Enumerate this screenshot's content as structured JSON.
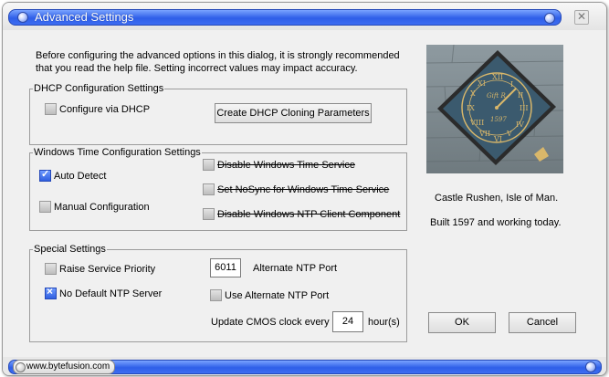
{
  "window": {
    "title": "Advanced Settings",
    "close_glyph": "✕"
  },
  "intro": {
    "line1": "Before configuring the advanced options in this dialog, it is strongly recommended",
    "line2": "that you read the help file. Setting incorrect values may impact accuracy."
  },
  "dhcp": {
    "legend": "DHCP Configuration Settings",
    "configure_label": "Configure via DHCP",
    "configure_checked": false,
    "create_button": "Create DHCP Cloning Parameters"
  },
  "windows_time": {
    "legend": "Windows Time  Configuration Settings",
    "auto_detect_label": "Auto Detect",
    "auto_detect_checked": true,
    "manual_label": "Manual Configuration",
    "manual_checked": false,
    "disable_service_label": "Disable Windows Time Service",
    "nosync_label": "Set NoSync for Windows Time Service",
    "disable_ntp_client_label": "Disable Windows NTP Client Component"
  },
  "special": {
    "legend": "Special Settings",
    "raise_priority_label": "Raise Service Priority",
    "no_default_ntp_label": "No Default NTP Server",
    "port_value": "6011",
    "alt_port_label": "Alternate NTP Port",
    "use_alt_port_label": "Use Alternate NTP Port",
    "cmos_label": "Update CMOS clock every",
    "cmos_value": "24",
    "cmos_unit": "hour(s)"
  },
  "photo": {
    "caption1": "Castle Rushen, Isle of Man.",
    "caption2": "Built 1597 and working today.",
    "clock_text_top": "Gift R",
    "clock_year": "1597"
  },
  "buttons": {
    "ok": "OK",
    "cancel": "Cancel"
  },
  "status": {
    "url": "www.bytefusion.com"
  },
  "colors": {
    "accent": "#2f5fe8",
    "clock_face": "#3b5a6e",
    "clock_gold": "#d9b76a"
  }
}
